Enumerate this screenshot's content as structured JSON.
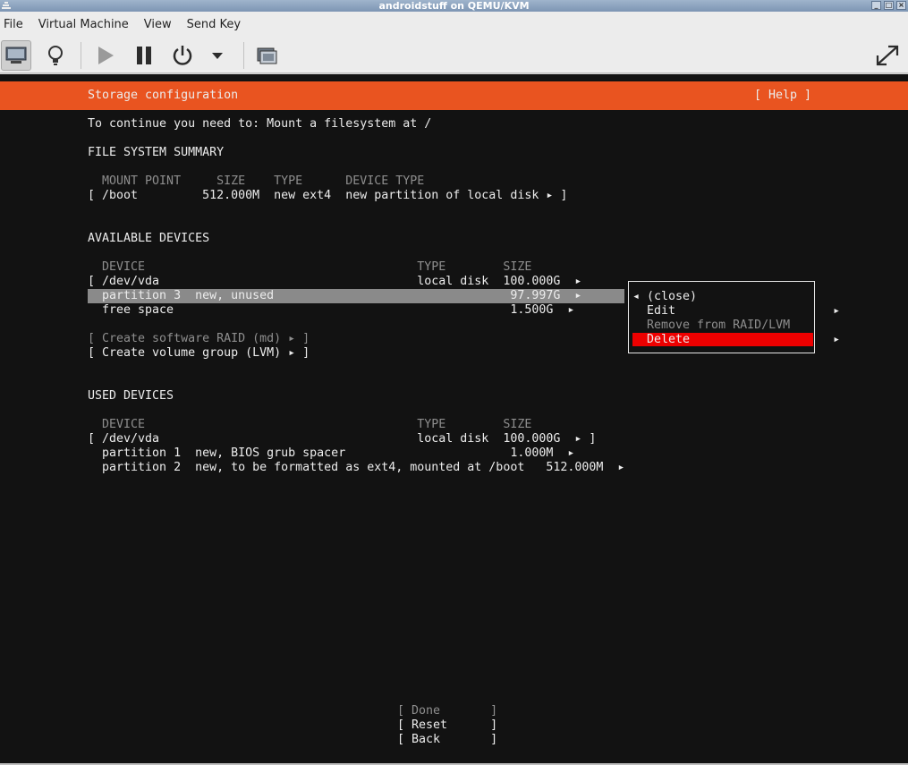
{
  "window": {
    "title": "androidstuff on QEMU/KVM",
    "buttons": [
      "minimize",
      "maximize",
      "close"
    ]
  },
  "menubar": {
    "items": [
      {
        "label": "File"
      },
      {
        "label": "Virtual Machine"
      },
      {
        "label": "View"
      },
      {
        "label": "Send Key"
      }
    ]
  },
  "toolbar": {
    "icons": [
      "monitor-icon",
      "lightbulb-icon",
      "play-icon",
      "pause-icon",
      "power-icon",
      "dropdown-arrow-icon",
      "screenshot-icon",
      "fullscreen-icon"
    ]
  },
  "installer": {
    "header_title": "Storage configuration",
    "help": "[ Help ]",
    "instruction": "To continue you need to: Mount a filesystem at /",
    "fs_summary": {
      "title": "FILE SYSTEM SUMMARY",
      "header": "  MOUNT POINT     SIZE    TYPE      DEVICE TYPE",
      "rows": [
        "[ /boot         512.000M  new ext4  new partition of local disk ▸ ]"
      ]
    },
    "available": {
      "title": "AVAILABLE DEVICES",
      "header": "  DEVICE                                      TYPE        SIZE",
      "rows": [
        "[ /dev/vda                                    local disk  100.000G  ▸",
        "  partition 3  new, unused                                 97.997G  ▸",
        "  free space                                               1.500G  ▸"
      ],
      "create_raid": "[ Create software RAID (md) ▸ ]",
      "create_lvm": "[ Create volume group (LVM) ▸ ]"
    },
    "used": {
      "title": "USED DEVICES",
      "header": "  DEVICE                                      TYPE        SIZE",
      "rows": [
        "[ /dev/vda                                    local disk  100.000G  ▸ ]",
        "  partition 1  new, BIOS grub spacer                       1.000M  ▸",
        "  partition 2  new, to be formatted as ext4, mounted at /boot   512.000M  ▸"
      ]
    },
    "popup": {
      "items": [
        {
          "label": "◂ (close)",
          "enabled": true
        },
        {
          "label": "  Edit                      ▸",
          "enabled": true
        },
        {
          "label": "  Remove from RAID/LVM",
          "enabled": false
        },
        {
          "label": "  Delete                    ▸",
          "enabled": true,
          "selected": true
        }
      ]
    },
    "buttons": {
      "done": "[ Done       ]",
      "reset": "[ Reset      ]",
      "back": "[ Back       ]"
    }
  },
  "colors": {
    "accent": "#e95420",
    "selection": "#8a8a8a",
    "danger": "#ee0000",
    "console_bg": "#121212"
  }
}
